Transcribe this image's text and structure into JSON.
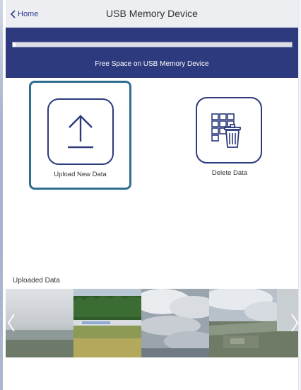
{
  "header": {
    "back_label": "Home",
    "title": "USB Memory Device"
  },
  "storage": {
    "label": "Free Space on USB Memory Device",
    "used_fraction": 0.01
  },
  "actions": {
    "upload_label": "Upload New Data",
    "delete_label": "Delete Data"
  },
  "uploaded": {
    "section_label": "Uploaded Data",
    "thumbnails": [
      "landscape-hazy",
      "forest-field",
      "cloudy-sky",
      "aerial-clouds",
      "landscape-edge"
    ]
  },
  "colors": {
    "accent": "#2d3a7d",
    "selection_border": "#2f6e91",
    "topbar": "#eceef2"
  },
  "icons": {
    "back": "chevron-left-icon",
    "upload": "upload-arrow-icon",
    "delete": "grid-trash-icon",
    "prev": "chevron-left-icon",
    "next": "chevron-right-icon"
  }
}
